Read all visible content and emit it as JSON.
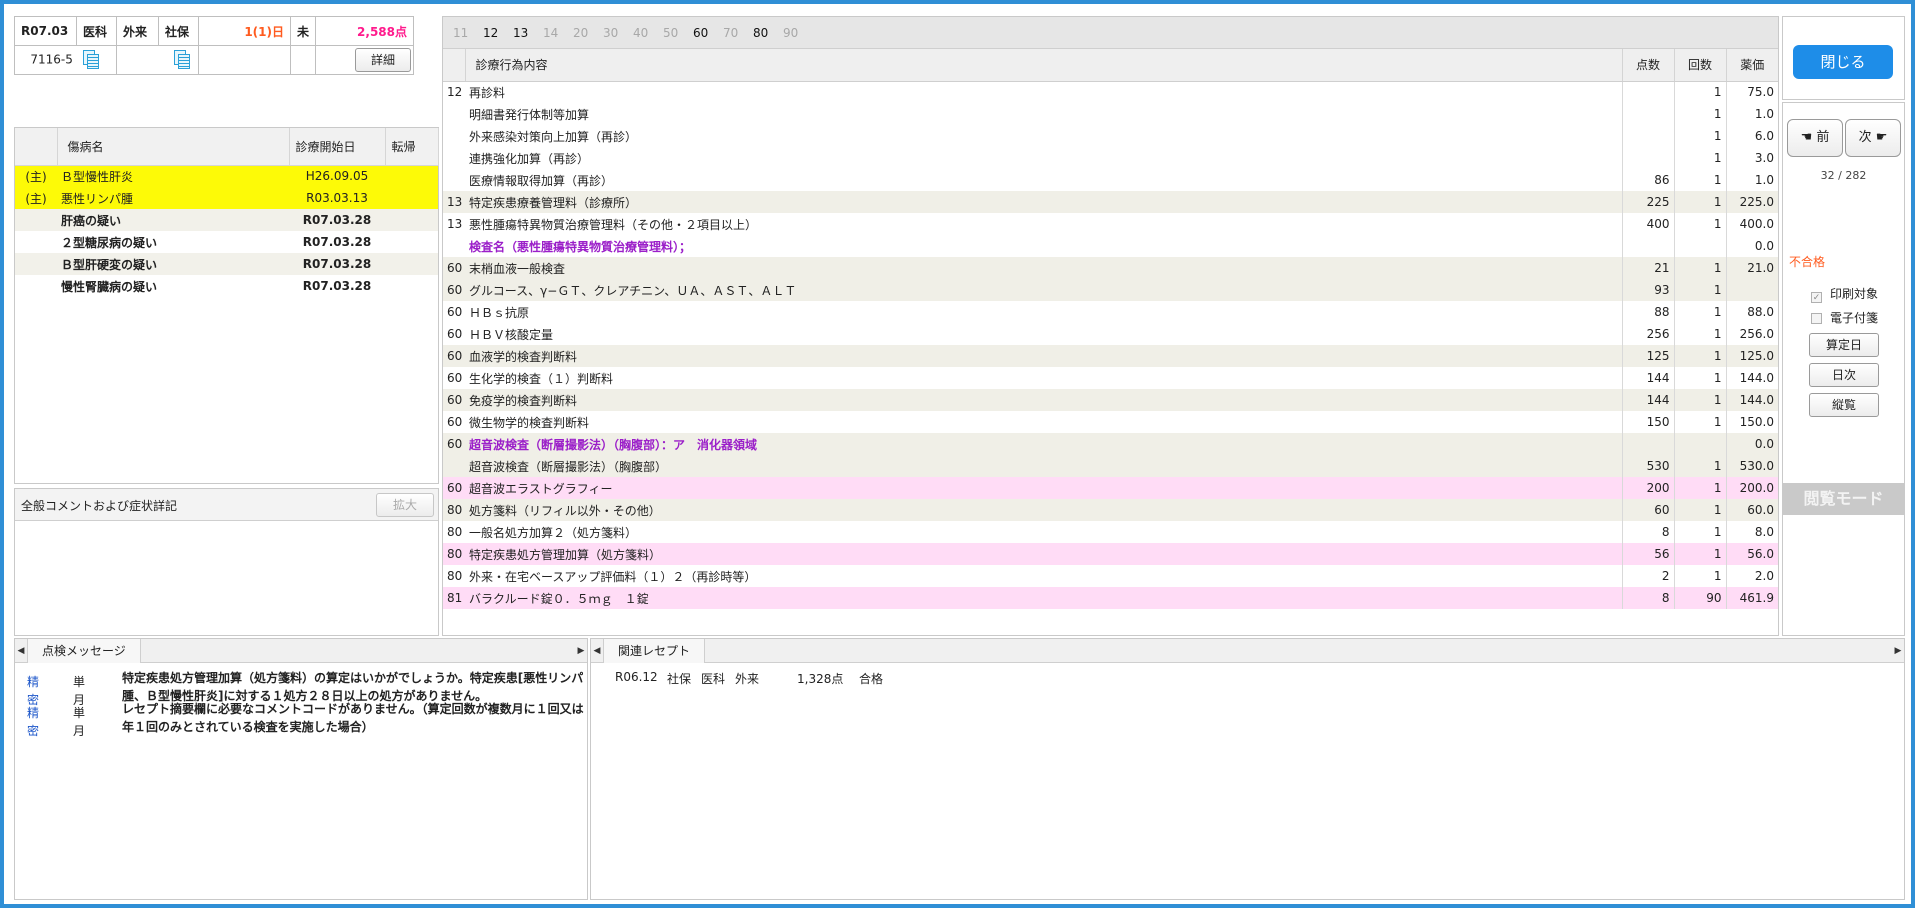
{
  "header": {
    "date": "R07.03",
    "dept": "医科",
    "visit_type": "外来",
    "insurance": "社保",
    "days": "1(1)日",
    "status": "未",
    "points": "2,588点",
    "patient_id": "7116-5",
    "detail_label": "詳細"
  },
  "diseases": {
    "col_name": "傷病名",
    "col_start": "診療開始日",
    "col_outcome": "転帰",
    "rows": [
      {
        "main": "(主)",
        "name": "Ｂ型慢性肝炎",
        "start": "H26.09.05",
        "outcome": ""
      },
      {
        "main": "(主)",
        "name": "悪性リンパ腫",
        "start": "R03.03.13",
        "outcome": ""
      },
      {
        "main": "",
        "name": "肝癌の疑い",
        "start": "R07.03.28",
        "outcome": ""
      },
      {
        "main": "",
        "name": "２型糖尿病の疑い",
        "start": "R07.03.28",
        "outcome": ""
      },
      {
        "main": "",
        "name": "Ｂ型肝硬変の疑い",
        "start": "R07.03.28",
        "outcome": ""
      },
      {
        "main": "",
        "name": "慢性腎臓病の疑い",
        "start": "R07.03.28",
        "outcome": ""
      }
    ]
  },
  "comment": {
    "title": "全般コメントおよび症状詳記",
    "expand_label": "拡大"
  },
  "procedures": {
    "tabs": [
      {
        "label": "11",
        "active": false
      },
      {
        "label": "12",
        "active": true
      },
      {
        "label": "13",
        "active": true
      },
      {
        "label": "14",
        "active": false
      },
      {
        "label": "20",
        "active": false
      },
      {
        "label": "30",
        "active": false
      },
      {
        "label": "40",
        "active": false
      },
      {
        "label": "50",
        "active": false
      },
      {
        "label": "60",
        "active": true
      },
      {
        "label": "70",
        "active": false
      },
      {
        "label": "80",
        "active": true
      },
      {
        "label": "90",
        "active": false
      }
    ],
    "col_name": "診療行為内容",
    "col_points": "点数",
    "col_count": "回数",
    "col_price": "薬価",
    "rows": [
      {
        "code": "12",
        "name": "再診料",
        "points": "",
        "count": "1",
        "price": "75.0",
        "style": ""
      },
      {
        "code": "",
        "name": "明細書発行体制等加算",
        "points": "",
        "count": "1",
        "price": "1.0",
        "style": ""
      },
      {
        "code": "",
        "name": "外来感染対策向上加算（再診）",
        "points": "",
        "count": "1",
        "price": "6.0",
        "style": ""
      },
      {
        "code": "",
        "name": "連携強化加算（再診）",
        "points": "",
        "count": "1",
        "price": "3.0",
        "style": ""
      },
      {
        "code": "",
        "name": "医療情報取得加算（再診）",
        "points": "86",
        "count": "1",
        "price": "1.0",
        "style": ""
      },
      {
        "code": "13",
        "name": "特定疾患療養管理料（診療所）",
        "points": "225",
        "count": "1",
        "price": "225.0",
        "style": "g"
      },
      {
        "code": "13",
        "name": "悪性腫瘍特異物質治療管理料（その他・２項目以上）",
        "points": "400",
        "count": "1",
        "price": "400.0",
        "style": ""
      },
      {
        "code": "",
        "name": "検査名（悪性腫瘍特異物質治療管理料）；",
        "points": "",
        "count": "",
        "price": "0.0",
        "style": "pu"
      },
      {
        "code": "60",
        "name": "末梢血液一般検査",
        "points": "21",
        "count": "1",
        "price": "21.0",
        "style": "g"
      },
      {
        "code": "60",
        "name": "グルコース、γ−ＧＴ、クレアチニン、ＵＡ、ＡＳＴ、ＡＬＴ",
        "points": "93",
        "count": "1",
        "price": "",
        "style": "g"
      },
      {
        "code": "60",
        "name": "ＨＢｓ抗原",
        "points": "88",
        "count": "1",
        "price": "88.0",
        "style": ""
      },
      {
        "code": "60",
        "name": "ＨＢＶ核酸定量",
        "points": "256",
        "count": "1",
        "price": "256.0",
        "style": ""
      },
      {
        "code": "60",
        "name": "血液学的検査判断料",
        "points": "125",
        "count": "1",
        "price": "125.0",
        "style": "g"
      },
      {
        "code": "60",
        "name": "生化学的検査（１）判断料",
        "points": "144",
        "count": "1",
        "price": "144.0",
        "style": ""
      },
      {
        "code": "60",
        "name": "免疫学的検査判断料",
        "points": "144",
        "count": "1",
        "price": "144.0",
        "style": "g"
      },
      {
        "code": "60",
        "name": "微生物学的検査判断料",
        "points": "150",
        "count": "1",
        "price": "150.0",
        "style": ""
      },
      {
        "code": "60",
        "name": "超音波検査（断層撮影法）（胸腹部）：ア　消化器領域",
        "points": "",
        "count": "",
        "price": "0.0",
        "style": "g pu"
      },
      {
        "code": "",
        "name": "超音波検査（断層撮影法）（胸腹部）",
        "points": "530",
        "count": "1",
        "price": "530.0",
        "style": "g"
      },
      {
        "code": "60",
        "name": "超音波エラストグラフィー",
        "points": "200",
        "count": "1",
        "price": "200.0",
        "style": "p"
      },
      {
        "code": "80",
        "name": "処方箋料（リフィル以外・その他）",
        "points": "60",
        "count": "1",
        "price": "60.0",
        "style": "g"
      },
      {
        "code": "80",
        "name": "一般名処方加算２（処方箋料）",
        "points": "8",
        "count": "1",
        "price": "8.0",
        "style": ""
      },
      {
        "code": "80",
        "name": "特定疾患処方管理加算（処方箋料）",
        "points": "56",
        "count": "1",
        "price": "56.0",
        "style": "p"
      },
      {
        "code": "80",
        "name": "外来・在宅ベースアップ評価料（１）２（再診時等）",
        "points": "2",
        "count": "1",
        "price": "2.0",
        "style": ""
      },
      {
        "code": "81",
        "name": "バラクルード錠０．５ｍｇ　１錠",
        "points": "8",
        "count": "90",
        "price": "461.9",
        "style": "p"
      }
    ]
  },
  "side": {
    "close_label": "閉じる",
    "prev_label": "前",
    "next_label": "次",
    "page_counter": "32 / 282",
    "result_label": "不合格",
    "print_label": "印刷対象",
    "print_checked": true,
    "tag_label": "電子付箋",
    "tag_checked": false,
    "calc_date_label": "算定日",
    "daily_label": "日次",
    "vertical_label": "縦覧",
    "mode_label": "閲覧モード"
  },
  "messages": {
    "tab_label": "点検メッセージ",
    "items": [
      {
        "level": "精密",
        "period": "単月",
        "text": "特定疾患処方管理加算（処方箋料）の算定はいかがでしょうか。特定疾患[悪性リンパ腫、Ｂ型慢性肝炎]に対する１処方２８日以上の処方がありません。"
      },
      {
        "level": "精密",
        "period": "単月",
        "text": "レセプト摘要欄に必要なコメントコードがありません。（算定回数が複数月に１回又は年１回のみとされている検査を実施した場合）"
      }
    ]
  },
  "related": {
    "tab_label": "関連レセプト",
    "items": [
      {
        "date": "R06.12",
        "insurance": "社保",
        "dept": "医科",
        "visit": "外来",
        "points": "1,328点",
        "result": "合格"
      }
    ]
  },
  "colors": {
    "frame": "#2f8fd6",
    "main_row": "#fdfa07",
    "alt_row": "#f0efe7",
    "pink_row": "#ffdcf6",
    "purple_text": "#9b1fc9",
    "primary_button": "#1e8de8",
    "fail_text": "#ff5b1f"
  }
}
